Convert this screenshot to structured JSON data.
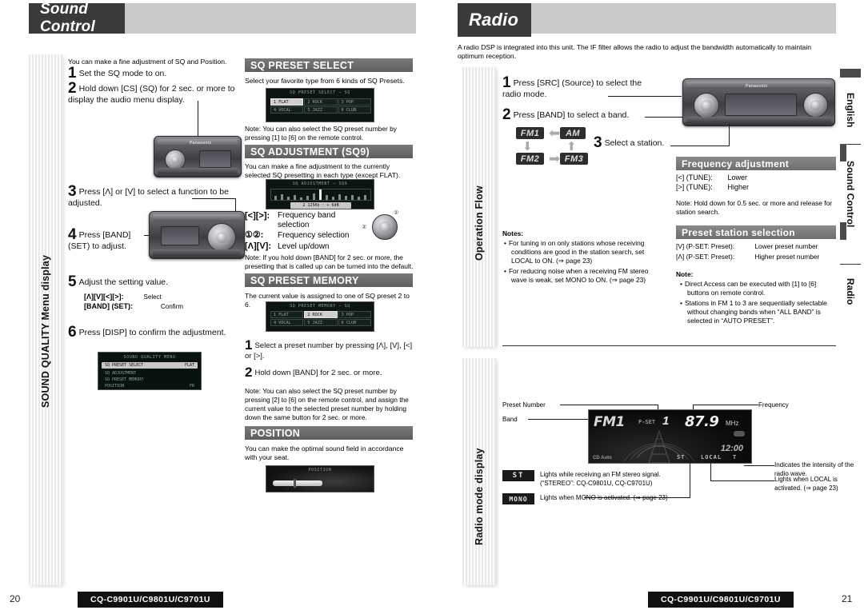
{
  "left_page": {
    "chapter_title": "Sound Control",
    "side_tab": "SOUND QUALITY Menu display",
    "intro": "You can make a fine adjustment of SQ and Position.",
    "steps": [
      {
        "num": "1",
        "text": "Set the SQ mode to on."
      },
      {
        "num": "2",
        "text": "Hold down [CS] (SQ) for 2 sec. or more to display the audio menu display."
      },
      {
        "num": "3",
        "text": "Press [Λ] or [V] to select a function to be adjusted."
      },
      {
        "num": "4",
        "text": "Press [BAND] (SET) to adjust."
      },
      {
        "num": "5",
        "text": "Adjust the setting value."
      },
      {
        "num": "6",
        "text": "Press [DISP] to confirm the adjustment."
      }
    ],
    "step5_keys": [
      {
        "key": "[Λ][V][<][>]:",
        "action": "Select"
      },
      {
        "key": "[BAND] (SET):",
        "action": "Confirm"
      }
    ],
    "sections": [
      {
        "id": "sq-preset-select",
        "title": "SQ PRESET SELECT",
        "lead": "Select your favorite type from 6 kinds of SQ Presets.",
        "note": "Note: You can also select the SQ preset number by pressing [1] to [6] on the remote control.",
        "lcd_title": "SQ PRESET SELECT — SQ",
        "presets": [
          {
            "n": "1",
            "name": "FLAT",
            "selected": true
          },
          {
            "n": "2",
            "name": "ROCK",
            "selected": false
          },
          {
            "n": "3",
            "name": "POP",
            "selected": false
          },
          {
            "n": "4",
            "name": "VOCAL",
            "selected": false
          },
          {
            "n": "5",
            "name": "JAZZ",
            "selected": false
          },
          {
            "n": "6",
            "name": "CLUB",
            "selected": false
          }
        ]
      },
      {
        "id": "sq-adjustment",
        "title": "SQ ADJUSTMENT (SQ9)",
        "lead": "You can make a fine adjustment to the currently selected SQ presetting in each type (except FLAT).",
        "lcd_title": "SQ ADJUSTMENT — SQ9",
        "lcd_value": "2  125Hz : + 6dB",
        "keys": [
          {
            "key": "[<][>]:",
            "action": "Frequency band selection"
          },
          {
            "key": "①②:",
            "action": "Frequency selection"
          },
          {
            "key": "[Λ][V]:",
            "action": "Level up/down"
          }
        ],
        "note": "Note: If you hold down [BAND] for 2 sec. or more, the presetting that is called up can be turned into the default."
      },
      {
        "id": "sq-preset-memory",
        "title": "SQ PRESET MEMORY",
        "lead": "The current value is assigned to one of SQ preset 2 to 6.",
        "lcd_title": "SQ PRESET MEMORY — SQ",
        "presets": [
          {
            "n": "1",
            "name": "FLAT",
            "selected": false
          },
          {
            "n": "2",
            "name": "ROCK",
            "selected": true
          },
          {
            "n": "3",
            "name": "POP",
            "selected": false
          },
          {
            "n": "4",
            "name": "VOCAL",
            "selected": false
          },
          {
            "n": "5",
            "name": "JAZZ",
            "selected": false
          },
          {
            "n": "6",
            "name": "CLUB",
            "selected": false
          }
        ],
        "steps": [
          {
            "num": "1",
            "text": "Select a preset number by pressing [Λ], [V], [<] or [>]."
          },
          {
            "num": "2",
            "text": "Hold down [BAND] for 2 sec. or more."
          }
        ],
        "note": "Note: You can also select the SQ preset number by pressing [2] to [6] on the remote control, and assign the current value to the selected preset number by holding down the same button for 2 sec. or more."
      },
      {
        "id": "position",
        "title": "POSITION",
        "lead": "You can make the optimal sound field in accordance with your seat.",
        "lcd_title": "POSITION"
      }
    ],
    "menu_lcd": {
      "title": "SOUND QUALITY MENU",
      "rows": [
        {
          "label": "SQ PRESET SELECT",
          "value": "FLAT",
          "selected": true
        },
        {
          "label": "SQ ADJUSTMENT",
          "value": "",
          "selected": false
        },
        {
          "label": "SQ PRESET MEMORY",
          "value": "",
          "selected": false
        },
        {
          "label": "POSITION",
          "value": "FR",
          "selected": false
        }
      ]
    },
    "unit_brand": "Panasonic",
    "footer_model": "CQ-C9901U/C9801U/C9701U",
    "page_number": "20"
  },
  "right_page": {
    "chapter_title": "Radio",
    "intro": "A radio DSP is integrated into this unit. The IF filter allows the radio to adjust the bandwidth automatically to maintain optimum reception.",
    "side_tab_top": "Operation Flow",
    "side_tab_bottom": "Radio mode display",
    "steps": [
      {
        "num": "1",
        "text": "Press [SRC] (Source) to select the radio mode."
      },
      {
        "num": "2",
        "text": "Press [BAND] to select a band."
      },
      {
        "num": "3",
        "text": "Select a station."
      }
    ],
    "band_flow": {
      "chips": [
        "FM1",
        "AM",
        "FM2",
        "FM3"
      ]
    },
    "notes_left": {
      "title": "Notes:",
      "items": [
        "For tuning in on only stations whose receiving conditions are good in the station search, set LOCAL to ON. (⇒ page 23)",
        "For reducing noise when a receiving FM stereo wave is weak, set MONO to ON. (⇒ page 23)"
      ]
    },
    "frequency_adjustment": {
      "title": "Frequency adjustment",
      "rows": [
        {
          "key": "[<] (TUNE):",
          "action": "Lower"
        },
        {
          "key": "[>] (TUNE):",
          "action": "Higher"
        }
      ],
      "note": "Note: Hold down for 0.5 sec. or more and release for station search."
    },
    "preset_station_selection": {
      "title": "Preset station selection",
      "rows": [
        {
          "key": "[V] (P-SET: Preset):",
          "action": "Lower preset number"
        },
        {
          "key": "[Λ] (P-SET: Preset):",
          "action": "Higher preset number"
        }
      ],
      "note_title": "Note:",
      "note_items": [
        "Direct Access can be executed with [1] to [6] buttons on remote control.",
        "Stations in FM 1 to 3 are sequentially selectable without changing bands when “ALL BAND” is selected in “AUTO PRESET”."
      ]
    },
    "radio_display": {
      "callouts": {
        "preset_number": "Preset Number",
        "band": "Band",
        "frequency": "Frequency",
        "intensity": "Indicates the intensity of the radio wave.",
        "local": "Lights when LOCAL is activated. (⇒ page 23)"
      },
      "lcd": {
        "band": "FM1",
        "pset_label": "P-SET",
        "preset_number": "1",
        "freq_value": "87.9",
        "freq_unit": "MHz",
        "clock": "12:00",
        "source_label": "CD Auto",
        "ind_st": "ST",
        "ind_local": "LOCAL",
        "ind_signal": "T"
      },
      "legend": [
        {
          "chip": "ST",
          "text": "Lights while receiving an FM stereo signal. (“STEREO”: CQ-C9801U, CQ-C9701U)"
        },
        {
          "chip": "MONO",
          "text": "Lights when MONO is activated. (⇒ page 23)"
        }
      ]
    },
    "unit_brand": "Panasonic",
    "footer_model": "CQ-C9901U/C9801U/C9701U",
    "page_number": "21"
  },
  "edge_tabs": [
    {
      "label": "English"
    },
    {
      "label": "Sound Control"
    },
    {
      "label": "Radio"
    }
  ]
}
